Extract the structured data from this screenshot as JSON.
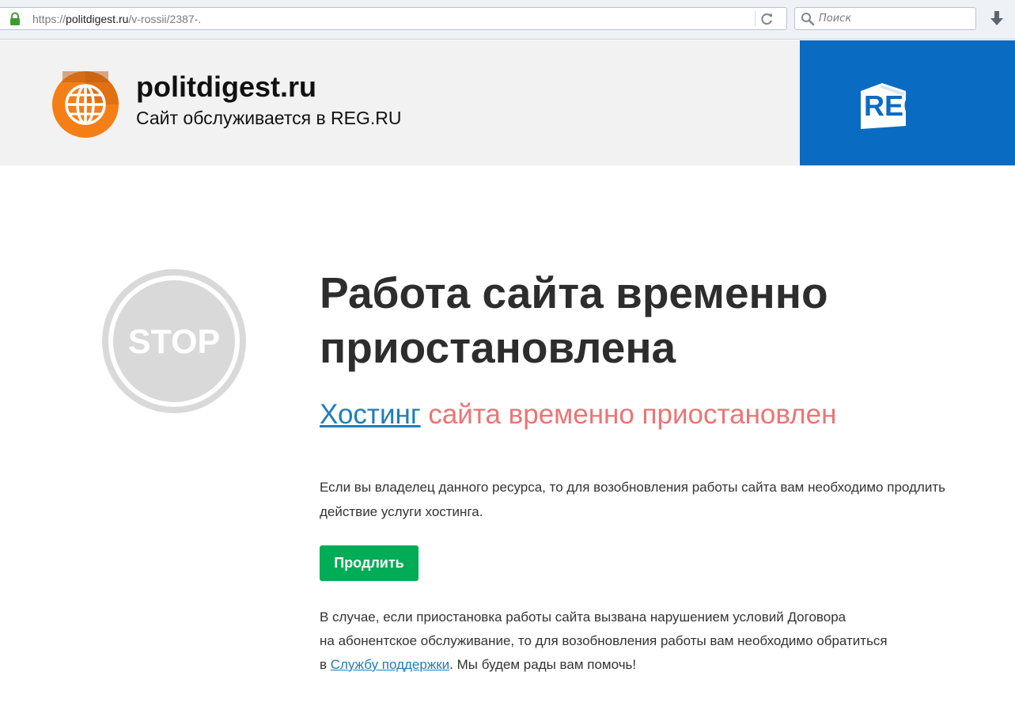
{
  "browser": {
    "url_prefix": "https://",
    "url_host": "politdigest.ru",
    "url_path": "/v-rossii/2387-.",
    "search_placeholder": "Поиск"
  },
  "header": {
    "site_name": "politdigest.ru",
    "site_subtitle": "Сайт обслуживается в REG.RU",
    "brand_logo_text": "REG.RU",
    "brand_color": "#0a6bc2",
    "site_logo_color": "#f47f16"
  },
  "main": {
    "stop_text": "STOP",
    "title": "Работа сайта временно приостановлена",
    "subtitle_link": "Хостинг",
    "subtitle_rest": " сайта временно приостановлен",
    "paragraph1": "Если вы владелец данного ресурса, то для возобновления работы сайта вам необходимо продлить действие услуги хостинга.",
    "renew_button": "Продлить",
    "paragraph2_line1": "В случае, если приостановка работы сайта вызвана нарушением условий Договора",
    "paragraph2_line2": "на абонентское обслуживание, то для возобновления работы вам необходимо обратиться",
    "paragraph2_prefix": "в ",
    "support_link": "Службу поддержки",
    "paragraph2_suffix": ". Мы будем рады вам помочь!",
    "accent_green": "#00ad56",
    "link_color": "#1e7db8",
    "subtitle_color": "#ec7474"
  }
}
